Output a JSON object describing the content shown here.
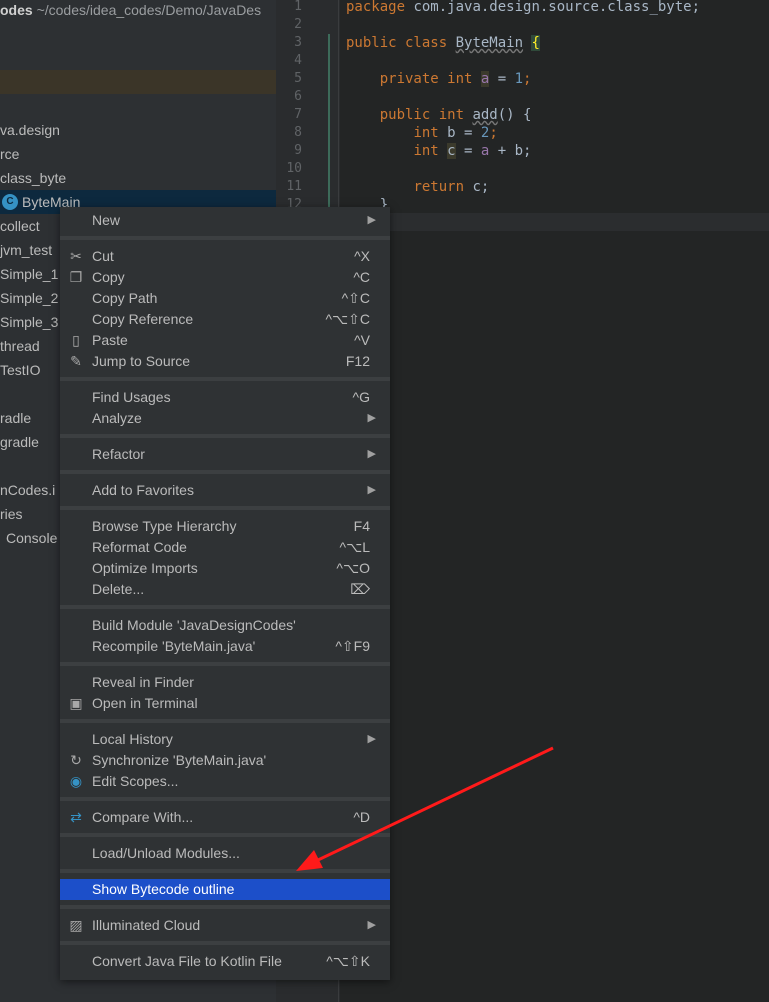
{
  "sidebar": {
    "title_project": "odes",
    "title_path": "~/codes/idea_codes/Demo/JavaDes",
    "rows": [
      "va.design",
      "rce",
      "class_byte",
      "ByteMain",
      "collect",
      "jvm_test",
      "Simple_1",
      "Simple_2",
      "Simple_3",
      "thread",
      "TestIO",
      "radle",
      "gradle",
      "nCodes.i",
      "ries",
      "Console"
    ],
    "selected": "ByteMain",
    "class_icon_letter": "C"
  },
  "editor": {
    "line_numbers": [
      "1",
      "2",
      "3",
      "4",
      "5",
      "6",
      "7",
      "8",
      "9",
      "10",
      "11",
      "12"
    ],
    "code": {
      "l1_kw": "package",
      "l1_rest": " com.java.design.source.class_byte;",
      "l3_kw": "public class",
      "l3_name": "ByteMain",
      "l3_brace": "{",
      "l5_kw": "private int",
      "l5_var": "a",
      "l5_eq": " = ",
      "l5_num": "1",
      "l5_end": ";",
      "l7_kw": "public int",
      "l7_name": "add",
      "l7_rest": "() {",
      "l8_kw": "int",
      "l8_rest": " b = ",
      "l8_num": "2",
      "l8_end": ";",
      "l9_kw": "int",
      "l9_var": "c",
      "l9_eq": " = ",
      "l9_a": "a",
      "l9_rest": " + b;",
      "l11_kw": "return",
      "l11_rest": " c;",
      "l12": "}"
    }
  },
  "context_menu": {
    "groups": [
      [
        {
          "label": "New",
          "submenu": true
        }
      ],
      [
        {
          "label": "Cut",
          "shortcut": "^X",
          "icon": "scissors-icon"
        },
        {
          "label": "Copy",
          "shortcut": "^C",
          "icon": "copy-icon"
        },
        {
          "label": "Copy Path",
          "shortcut": "^⇧C"
        },
        {
          "label": "Copy Reference",
          "shortcut": "^⌥⇧C"
        },
        {
          "label": "Paste",
          "shortcut": "^V",
          "icon": "clipboard-icon"
        },
        {
          "label": "Jump to Source",
          "shortcut": "F12",
          "icon": "pencil-icon"
        }
      ],
      [
        {
          "label": "Find Usages",
          "shortcut": "^G"
        },
        {
          "label": "Analyze",
          "submenu": true
        }
      ],
      [
        {
          "label": "Refactor",
          "submenu": true
        }
      ],
      [
        {
          "label": "Add to Favorites",
          "submenu": true
        }
      ],
      [
        {
          "label": "Browse Type Hierarchy",
          "shortcut": "F4"
        },
        {
          "label": "Reformat Code",
          "shortcut": "^⌥L"
        },
        {
          "label": "Optimize Imports",
          "shortcut": "^⌥O"
        },
        {
          "label": "Delete...",
          "shortcut": "⌦"
        }
      ],
      [
        {
          "label": "Build Module 'JavaDesignCodes'"
        },
        {
          "label": "Recompile 'ByteMain.java'",
          "shortcut": "^⇧F9"
        }
      ],
      [
        {
          "label": "Reveal in Finder"
        },
        {
          "label": "Open in Terminal",
          "icon": "terminal-icon"
        }
      ],
      [
        {
          "label": "Local History",
          "submenu": true
        },
        {
          "label": "Synchronize 'ByteMain.java'",
          "icon": "sync-icon"
        },
        {
          "label": "Edit Scopes...",
          "icon": "scope-icon"
        }
      ],
      [
        {
          "label": "Compare With...",
          "shortcut": "^D",
          "icon": "compare-icon"
        }
      ],
      [
        {
          "label": "Load/Unload Modules..."
        }
      ],
      [
        {
          "label": "Show Bytecode outline",
          "active": true
        }
      ],
      [
        {
          "label": "Illuminated Cloud",
          "submenu": true,
          "icon": "illuminated-cloud-icon"
        }
      ],
      [
        {
          "label": "Convert Java File to Kotlin File",
          "shortcut": "^⌥⇧K"
        }
      ]
    ]
  },
  "colors": {
    "highlight": "#1c4fc9",
    "annotation_arrow": "#ff1a1a"
  }
}
